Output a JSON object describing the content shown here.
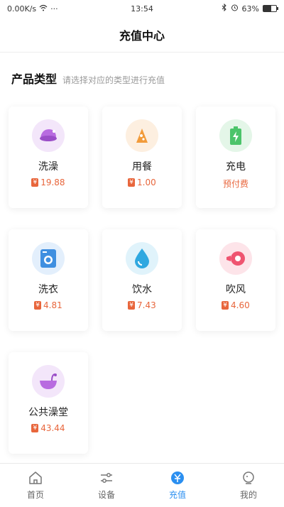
{
  "status": {
    "speed": "0.00K/s",
    "time": "13:54",
    "battery_percent": "63%",
    "battery_level": 0.63,
    "more": "···"
  },
  "nav": {
    "title": "充值中心"
  },
  "section": {
    "title": "产品类型",
    "subtitle": "请选择对应的类型进行充值"
  },
  "products": [
    {
      "name": "洗澡",
      "currency": "¥",
      "price": "19.88",
      "icon": "shower-bucket-icon",
      "color": "#b86be0"
    },
    {
      "name": "用餐",
      "currency": "¥",
      "price": "1.00",
      "icon": "meal-icon",
      "color": "#f29b3a"
    },
    {
      "name": "充电",
      "prepaid": "预付费",
      "icon": "battery-charge-icon",
      "color": "#4cc46a"
    },
    {
      "name": "洗衣",
      "currency": "¥",
      "price": "4.81",
      "icon": "washing-machine-icon",
      "color": "#3f8fe0"
    },
    {
      "name": "饮水",
      "currency": "¥",
      "price": "7.43",
      "icon": "water-drop-icon",
      "color": "#2fa8e0"
    },
    {
      "name": "吹风",
      "currency": "¥",
      "price": "4.60",
      "icon": "hair-dryer-icon",
      "color": "#ef5470"
    },
    {
      "name": "公共澡堂",
      "currency": "¥",
      "price": "43.44",
      "icon": "bathhouse-icon",
      "color": "#b86be0"
    }
  ],
  "tabs": [
    {
      "label": "首页",
      "icon": "home-icon",
      "active": false
    },
    {
      "label": "设备",
      "icon": "sliders-icon",
      "active": false
    },
    {
      "label": "充值",
      "icon": "recharge-icon",
      "active": true
    },
    {
      "label": "我的",
      "icon": "profile-icon",
      "active": false
    }
  ],
  "colors": {
    "accent": "#2b8ff0",
    "price": "#e8663c"
  }
}
